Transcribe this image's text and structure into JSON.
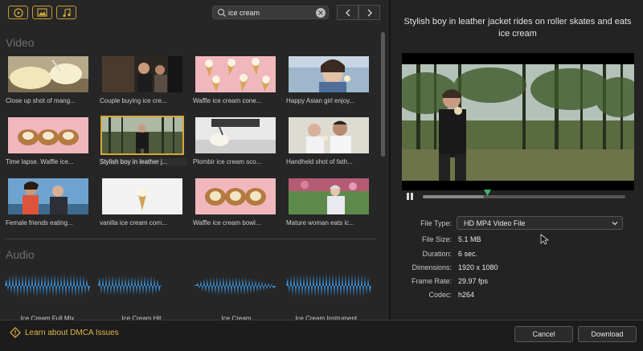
{
  "search": {
    "query": "ice cream"
  },
  "toolbar": {
    "video_filter": "video-filter",
    "image_filter": "image-filter",
    "audio_filter": "audio-filter"
  },
  "sections": {
    "video": "Video",
    "audio": "Audio"
  },
  "videos": [
    {
      "label": "Close up shot of mang..."
    },
    {
      "label": "Couple buying ice cre..."
    },
    {
      "label": "Waffle ice cream cone..."
    },
    {
      "label": "Happy Asian girl enjoy..."
    },
    {
      "label": "Time lapse. Waffle ice..."
    },
    {
      "label": "Stylish boy in leather j...",
      "selected": true
    },
    {
      "label": "Plombir ice cream sco..."
    },
    {
      "label": "Handheld shot of fath..."
    },
    {
      "label": "Female friends eating..."
    },
    {
      "label": "vanilla ice cream corn..."
    },
    {
      "label": "Waffle ice cream bowl..."
    },
    {
      "label": "Mature woman eats ic..."
    }
  ],
  "audio": [
    {
      "label": "Ice Cream Full Mix"
    },
    {
      "label": "Ice Cream Hit"
    },
    {
      "label": "Ice Cream"
    },
    {
      "label": "Ice Cream Instrument..."
    }
  ],
  "preview": {
    "title": "Stylish boy in leather jacket rides on roller skates and eats ice cream",
    "progress_fraction": 0.3
  },
  "details": {
    "file_type_label": "File Type:",
    "file_type_value": "HD MP4 Video File",
    "file_size_label": "File Size:",
    "file_size_value": "5.1 MB",
    "duration_label": "Duration:",
    "duration_value": "6 sec.",
    "dimensions_label": "Dimensions:",
    "dimensions_value": "1920 x 1080",
    "frame_rate_label": "Frame Rate:",
    "frame_rate_value": "29.97 fps",
    "codec_label": "Codec:",
    "codec_value": "h264"
  },
  "footer": {
    "dmca_link": "Learn about DMCA Issues",
    "cancel": "Cancel",
    "download": "Download"
  },
  "colors": {
    "accent": "#d4a93a",
    "wave": "#3a8fd6",
    "bg": "#262626"
  }
}
